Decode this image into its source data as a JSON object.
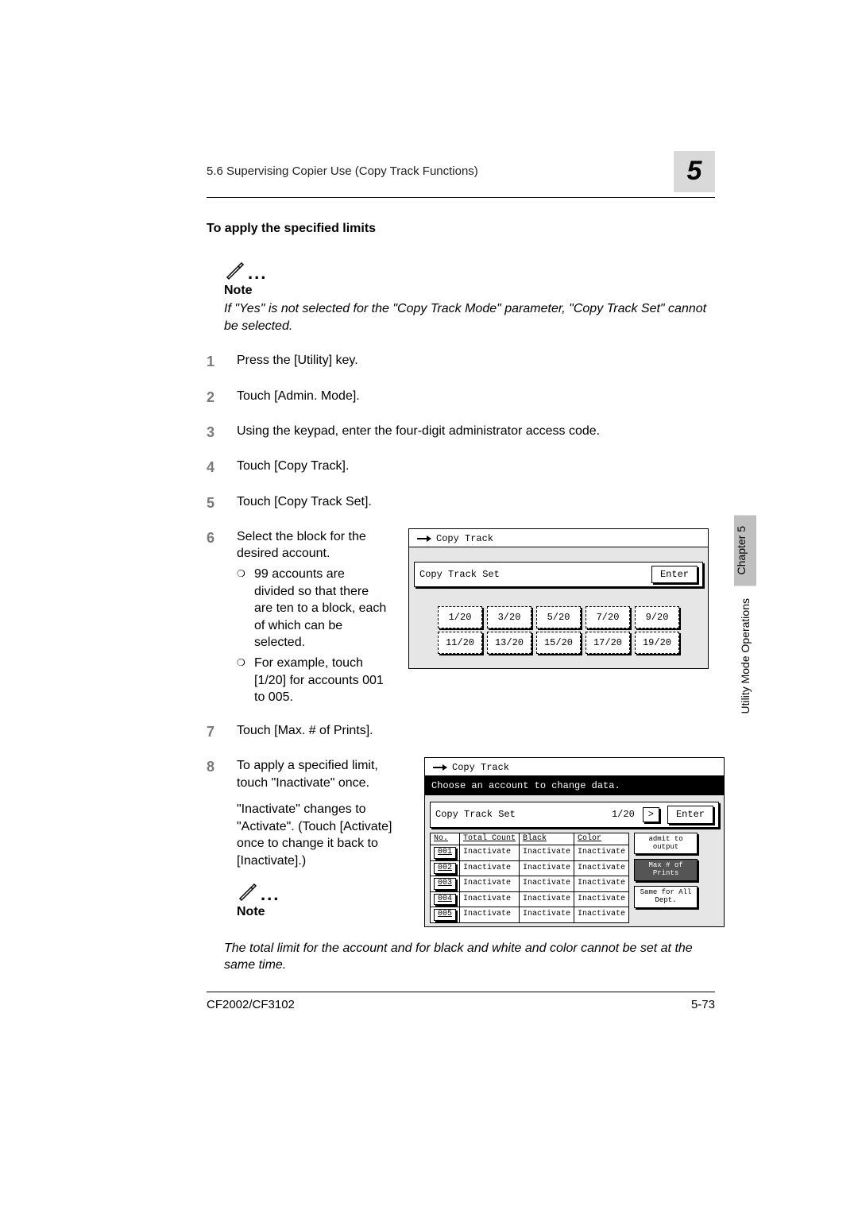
{
  "header": {
    "section_title": "5.6 Supervising Copier Use (Copy Track Functions)",
    "chapter_num": "5"
  },
  "subheading": "To apply the specified limits",
  "note1": {
    "title": "Note",
    "body": "If \"Yes\" is not selected for the \"Copy Track Mode\" parameter, \"Copy Track Set\" cannot be selected."
  },
  "steps": {
    "s1": "Press the [Utility] key.",
    "s2": "Touch [Admin. Mode].",
    "s3": "Using the keypad, enter the four-digit administrator access code.",
    "s4": "Touch [Copy Track].",
    "s5": "Touch [Copy Track Set].",
    "s6": {
      "main": "Select the block for the desired account.",
      "b1": "99 accounts are divided so that there are ten to a block, each of which can be selected.",
      "b2": "For example, touch [1/20] for accounts 001 to 005."
    },
    "s7": "Touch [Max. # of Prints].",
    "s8": {
      "p1": "To apply a specified limit, touch \"Inactivate\" once.",
      "p2": "\"Inactivate\" changes to \"Activate\". (Touch [Activate] once to change it back to [Inactivate].)"
    }
  },
  "panel1": {
    "title": "Copy Track",
    "bar_label": "Copy Track Set",
    "enter": "Enter",
    "blocks": [
      "1/20",
      "3/20",
      "5/20",
      "7/20",
      "9/20",
      "11/20",
      "13/20",
      "15/20",
      "17/20",
      "19/20"
    ]
  },
  "panel2": {
    "title": "Copy Track",
    "instruction": "Choose an account to change data.",
    "bar_label": "Copy Track Set",
    "page": "1/20",
    "nav": ">",
    "enter": "Enter",
    "headers": {
      "no": "No.",
      "total": "Total Count",
      "black": "Black",
      "color": "Color"
    },
    "rows": [
      {
        "no": "001",
        "total": "Inactivate",
        "black": "Inactivate",
        "color": "Inactivate"
      },
      {
        "no": "002",
        "total": "Inactivate",
        "black": "Inactivate",
        "color": "Inactivate"
      },
      {
        "no": "003",
        "total": "Inactivate",
        "black": "Inactivate",
        "color": "Inactivate"
      },
      {
        "no": "004",
        "total": "Inactivate",
        "black": "Inactivate",
        "color": "Inactivate"
      },
      {
        "no": "005",
        "total": "Inactivate",
        "black": "Inactivate",
        "color": "Inactivate"
      }
    ],
    "side": {
      "admit": "admit to output",
      "max": "Max # of Prints",
      "same": "Same for All Dept."
    }
  },
  "note2": {
    "title": "Note",
    "body": "The total limit for the account and for black and white and color cannot be set at the same time."
  },
  "side_tab": {
    "chapter": "Chapter 5",
    "label": "Utility Mode Operations"
  },
  "footer": {
    "model": "CF2002/CF3102",
    "page": "5-73"
  }
}
